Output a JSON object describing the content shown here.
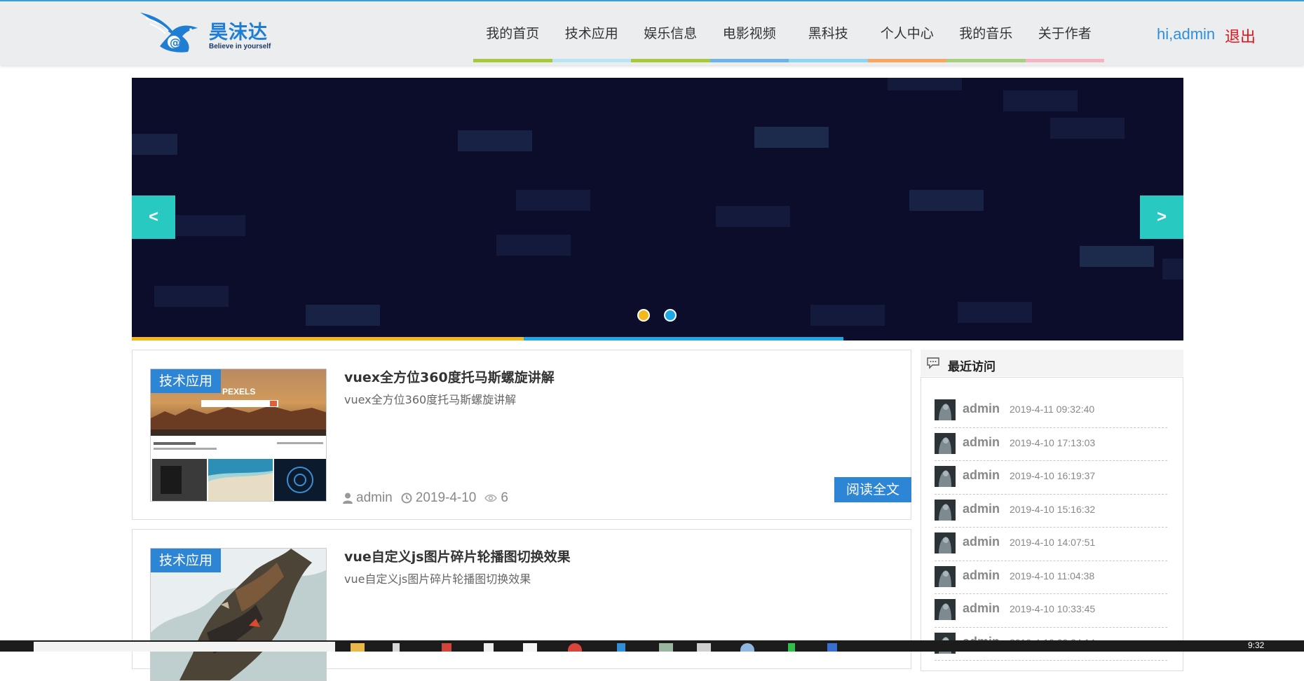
{
  "header": {
    "logo": {
      "name": "昊沫达",
      "slogan": "Believe in yourself"
    },
    "nav": [
      {
        "label": "我的首页",
        "color": "#a5c93a"
      },
      {
        "label": "技术应用",
        "color": "#b9e4f3"
      },
      {
        "label": "娱乐信息",
        "color": "#a5c93a"
      },
      {
        "label": "电影视频",
        "color": "#6fb2ea"
      },
      {
        "label": "黑科技",
        "color": "#8dd6f2"
      },
      {
        "label": "个人中心",
        "color": "#f9a660"
      },
      {
        "label": "我的音乐",
        "color": "#a6cf7f"
      },
      {
        "label": "关于作者",
        "color": "#f6b3c2"
      }
    ],
    "user": {
      "greeting": "hi,admin",
      "logout": "退出"
    }
  },
  "banner": {
    "prev_label": "<",
    "next_label": ">",
    "dots": [
      {
        "color": "#f5b81b",
        "active": true
      },
      {
        "color": "#1ea9e6",
        "active": false
      }
    ]
  },
  "articles": [
    {
      "tag": "技术应用",
      "title": "vuex全方位360度托马斯螺旋讲解",
      "desc": "vuex全方位360度托马斯螺旋讲解",
      "author": "admin",
      "date": "2019-4-10",
      "views": "6",
      "read_more": "阅读全文",
      "thumb_text": "PEXELS"
    },
    {
      "tag": "技术应用",
      "title": "vue自定义js图片碎片轮播图切换效果",
      "desc": "vue自定义js图片碎片轮播图切换效果"
    }
  ],
  "sidebar": {
    "title": "最近访问",
    "visits": [
      {
        "name": "admin",
        "time": "2019-4-11 09:32:40"
      },
      {
        "name": "admin",
        "time": "2019-4-10 17:13:03"
      },
      {
        "name": "admin",
        "time": "2019-4-10 16:19:37"
      },
      {
        "name": "admin",
        "time": "2019-4-10 15:16:32"
      },
      {
        "name": "admin",
        "time": "2019-4-10 14:07:51"
      },
      {
        "name": "admin",
        "time": "2019-4-10 11:04:38"
      },
      {
        "name": "admin",
        "time": "2019-4-10 10:33:45"
      },
      {
        "name": "admin",
        "time": "2019-4-10 09:24:14"
      }
    ]
  },
  "taskbar": {
    "clock": "9:32"
  }
}
